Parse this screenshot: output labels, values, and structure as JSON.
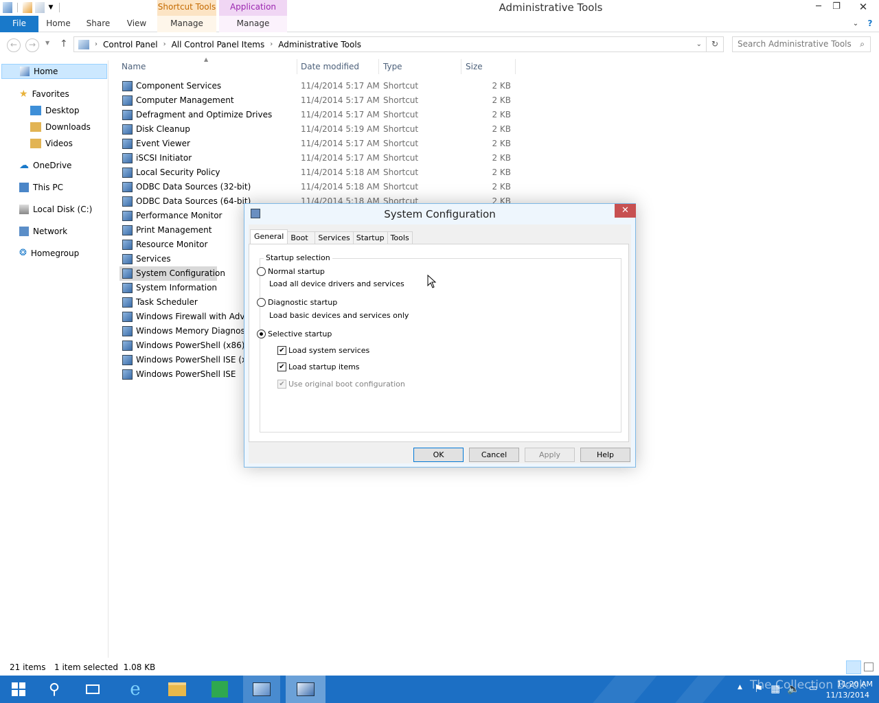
{
  "window": {
    "title": "Administrative Tools",
    "context_tabs": {
      "shortcut": "Shortcut Tools",
      "application": "Application Tools"
    },
    "controls": {
      "minimize": "─",
      "maximize": "❐",
      "close": "✕"
    }
  },
  "ribbon": {
    "file": "File",
    "home": "Home",
    "share": "Share",
    "view": "View",
    "manage_shortcut": "Manage",
    "manage_app": "Manage"
  },
  "address": {
    "crumbs": [
      "Control Panel",
      "All Control Panel Items",
      "Administrative Tools"
    ],
    "search_placeholder": "Search Administrative Tools"
  },
  "nav": {
    "home": "Home",
    "favorites": "Favorites",
    "desktop": "Desktop",
    "downloads": "Downloads",
    "videos": "Videos",
    "onedrive": "OneDrive",
    "this_pc": "This PC",
    "local_disk": "Local Disk (C:)",
    "network": "Network",
    "homegroup": "Homegroup"
  },
  "columns": {
    "name": "Name",
    "date": "Date modified",
    "type": "Type",
    "size": "Size"
  },
  "files": [
    {
      "name": "Component Services",
      "date": "11/4/2014 5:17 AM",
      "type": "Shortcut",
      "size": "2 KB"
    },
    {
      "name": "Computer Management",
      "date": "11/4/2014 5:17 AM",
      "type": "Shortcut",
      "size": "2 KB"
    },
    {
      "name": "Defragment and Optimize Drives",
      "date": "11/4/2014 5:17 AM",
      "type": "Shortcut",
      "size": "2 KB"
    },
    {
      "name": "Disk Cleanup",
      "date": "11/4/2014 5:19 AM",
      "type": "Shortcut",
      "size": "2 KB"
    },
    {
      "name": "Event Viewer",
      "date": "11/4/2014 5:17 AM",
      "type": "Shortcut",
      "size": "2 KB"
    },
    {
      "name": "iSCSI Initiator",
      "date": "11/4/2014 5:17 AM",
      "type": "Shortcut",
      "size": "2 KB"
    },
    {
      "name": "Local Security Policy",
      "date": "11/4/2014 5:18 AM",
      "type": "Shortcut",
      "size": "2 KB"
    },
    {
      "name": "ODBC Data Sources (32-bit)",
      "date": "11/4/2014 5:18 AM",
      "type": "Shortcut",
      "size": "2 KB"
    },
    {
      "name": "ODBC Data Sources (64-bit)",
      "date": "11/4/2014 5:18 AM",
      "type": "Shortcut",
      "size": "2 KB"
    },
    {
      "name": "Performance Monitor"
    },
    {
      "name": "Print Management"
    },
    {
      "name": "Resource Monitor"
    },
    {
      "name": "Services"
    },
    {
      "name": "System Configuration"
    },
    {
      "name": "System Information"
    },
    {
      "name": "Task Scheduler"
    },
    {
      "name": "Windows Firewall with Advan"
    },
    {
      "name": "Windows Memory Diagnostic"
    },
    {
      "name": "Windows PowerShell (x86)"
    },
    {
      "name": "Windows PowerShell ISE (x86)"
    },
    {
      "name": "Windows PowerShell ISE"
    }
  ],
  "status": {
    "count": "21 items",
    "selection": "1 item selected  1.08 KB"
  },
  "dialog": {
    "title": "System Configuration",
    "tabs": [
      "General",
      "Boot",
      "Services",
      "Startup",
      "Tools"
    ],
    "group_label": "Startup selection",
    "normal": "Normal startup",
    "normal_desc": "Load all device drivers and services",
    "diagnostic": "Diagnostic startup",
    "diagnostic_desc": "Load basic devices and services only",
    "selective": "Selective startup",
    "load_system": "Load system services",
    "load_startup": "Load startup items",
    "use_original": "Use original boot configuration",
    "ok": "OK",
    "cancel": "Cancel",
    "apply": "Apply",
    "help": "Help"
  },
  "taskbar": {
    "time": "11:20 AM",
    "date": "11/13/2014",
    "watermark": "The Collection Book"
  }
}
